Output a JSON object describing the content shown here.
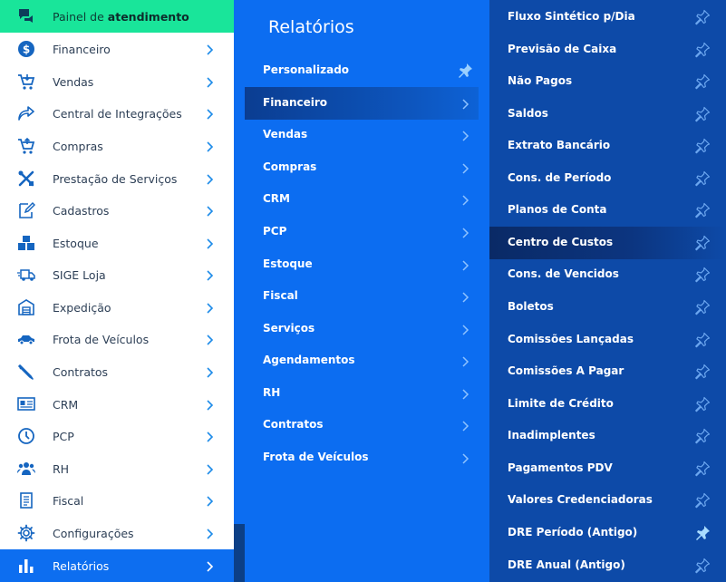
{
  "sidebar": {
    "items": [
      {
        "label_prefix": "Painel de ",
        "label_bold": "atendimento",
        "icon": "chat-icon"
      },
      {
        "label": "Financeiro",
        "icon": "dollar-icon"
      },
      {
        "label": "Vendas",
        "icon": "cart-icon"
      },
      {
        "label": "Central de Integrações",
        "icon": "share-arrow-icon"
      },
      {
        "label": "Compras",
        "icon": "cart-icon"
      },
      {
        "label": "Prestação de Serviços",
        "icon": "tools-icon"
      },
      {
        "label": "Cadastros",
        "icon": "edit-icon"
      },
      {
        "label": "Estoque",
        "icon": "boxes-icon"
      },
      {
        "label": "SIGE Loja",
        "icon": "truck-icon"
      },
      {
        "label": "Expedição",
        "icon": "warehouse-icon"
      },
      {
        "label": "Frota de Veículos",
        "icon": "car-icon"
      },
      {
        "label": "Contratos",
        "icon": "pen-icon"
      },
      {
        "label": "CRM",
        "icon": "id-card-icon"
      },
      {
        "label": "PCP",
        "icon": "clock-icon"
      },
      {
        "label": "RH",
        "icon": "users-icon"
      },
      {
        "label": "Fiscal",
        "icon": "document-icon"
      },
      {
        "label": "Configurações",
        "icon": "gear-icon"
      },
      {
        "label": "Relatórios",
        "icon": "bar-chart-icon"
      }
    ]
  },
  "middle": {
    "title": "Relatórios",
    "items": [
      {
        "label": "Personalizado"
      },
      {
        "label": "Financeiro"
      },
      {
        "label": "Vendas"
      },
      {
        "label": "Compras"
      },
      {
        "label": "CRM"
      },
      {
        "label": "PCP"
      },
      {
        "label": "Estoque"
      },
      {
        "label": "Fiscal"
      },
      {
        "label": "Serviços"
      },
      {
        "label": "Agendamentos"
      },
      {
        "label": "RH"
      },
      {
        "label": "Contratos"
      },
      {
        "label": "Frota de Veículos"
      }
    ]
  },
  "right": {
    "items": [
      {
        "label": "Fluxo Sintético p/Dia",
        "pinned": false
      },
      {
        "label": "Previsão de Caixa",
        "pinned": false
      },
      {
        "label": "Não Pagos",
        "pinned": false
      },
      {
        "label": "Saldos",
        "pinned": false
      },
      {
        "label": "Extrato Bancário",
        "pinned": false
      },
      {
        "label": "Cons. de Período",
        "pinned": false
      },
      {
        "label": "Planos de Conta",
        "pinned": false
      },
      {
        "label": "Centro de Custos",
        "pinned": false
      },
      {
        "label": "Cons. de Vencidos",
        "pinned": false
      },
      {
        "label": "Boletos",
        "pinned": false
      },
      {
        "label": "Comissões Lançadas",
        "pinned": false
      },
      {
        "label": "Comissões A Pagar",
        "pinned": false
      },
      {
        "label": "Limite de Crédito",
        "pinned": false
      },
      {
        "label": "Inadimplentes",
        "pinned": false
      },
      {
        "label": "Pagamentos PDV",
        "pinned": false
      },
      {
        "label": "Valores Credenciadoras",
        "pinned": false
      },
      {
        "label": "DRE Período (Antigo)",
        "pinned": true
      },
      {
        "label": "DRE Anual (Antigo)",
        "pinned": false
      }
    ]
  },
  "colors": {
    "top_item_bg": "#19e59a",
    "active_item_bg": "#0d6ef0",
    "middle_bg": "#0c6df1",
    "right_bg": "#0d4aa8"
  }
}
